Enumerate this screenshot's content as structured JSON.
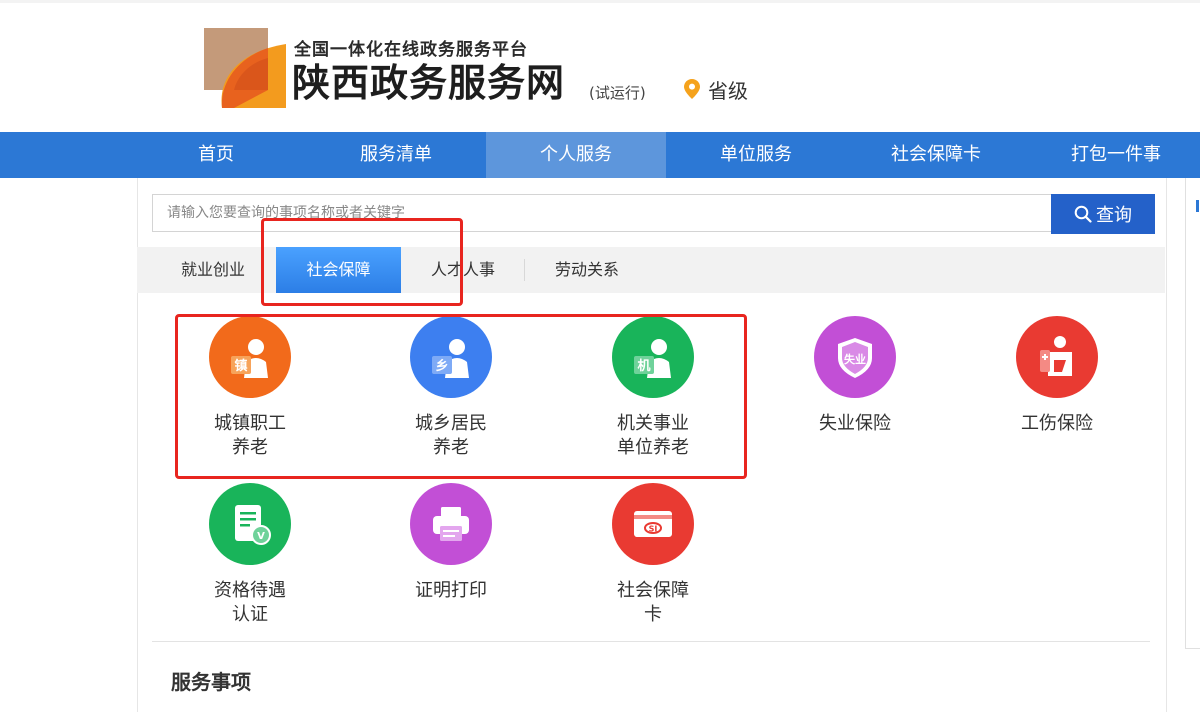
{
  "header": {
    "platform_line": "全国一体化在线政务服务平台",
    "site_title": "陕西政务服务网",
    "trial_label": "(试运行)",
    "region_label": "省级",
    "region_icon": "location-pin-icon",
    "logo_colors": [
      "#c49a7a",
      "#e8621e",
      "#f39b1e"
    ]
  },
  "nav": {
    "items": [
      {
        "label": "首页"
      },
      {
        "label": "服务清单"
      },
      {
        "label": "个人服务",
        "active": true
      },
      {
        "label": "单位服务"
      },
      {
        "label": "社会保障卡"
      },
      {
        "label": "打包一件事"
      }
    ],
    "bg_color": "#2c78d5"
  },
  "search": {
    "placeholder": "请输入您要查询的事项名称或者关键字",
    "value": "",
    "button_label": "查询",
    "button_icon": "search-icon"
  },
  "tabs": [
    {
      "label": "就业创业"
    },
    {
      "label": "社会保障",
      "active": true
    },
    {
      "label": "人才人事"
    },
    {
      "label": "劳动关系"
    }
  ],
  "services": [
    {
      "line1": "城镇职工",
      "line2": "养老",
      "icon": "urban-worker-pension-icon",
      "icon_text": "镇",
      "color": "#f26a1b"
    },
    {
      "line1": "城乡居民",
      "line2": "养老",
      "icon": "rural-resident-pension-icon",
      "icon_text": "乡",
      "color": "#3d7ff0"
    },
    {
      "line1": "机关事业",
      "line2": "单位养老",
      "icon": "institution-pension-icon",
      "icon_text": "机",
      "color": "#19b45a"
    },
    {
      "line1": "失业保险",
      "line2": "",
      "icon": "unemployment-insurance-icon",
      "icon_text": "失业",
      "color": "#c24fd6"
    },
    {
      "line1": "工伤保险",
      "line2": "",
      "icon": "work-injury-insurance-icon",
      "icon_text": "",
      "color": "#e93a32"
    },
    {
      "line1": "资格待遇",
      "line2": "认证",
      "icon": "qualification-certification-icon",
      "icon_text": "V",
      "color": "#19b45a"
    },
    {
      "line1": "证明打印",
      "line2": "",
      "icon": "printer-icon",
      "icon_text": "",
      "color": "#c24fd6"
    },
    {
      "line1": "社会保障",
      "line2": "卡",
      "icon": "social-security-card-icon",
      "icon_text": "SI",
      "color": "#e93a32"
    }
  ],
  "section": {
    "title": "服务事项"
  },
  "highlight_color": "#e8251f"
}
